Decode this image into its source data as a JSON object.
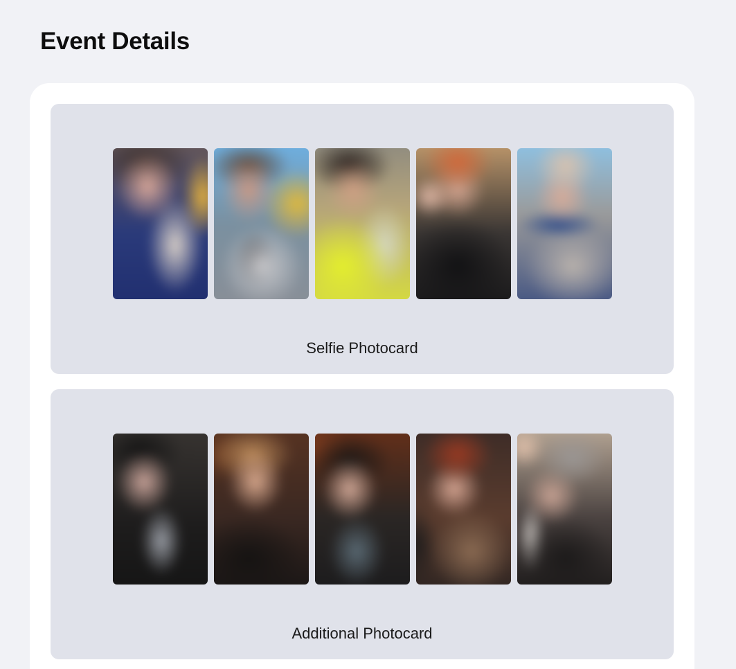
{
  "header": {
    "title": "Event Details"
  },
  "sections": [
    {
      "label": "Selfie Photocard",
      "photocards": [
        {
          "icon": "photocard-image"
        },
        {
          "icon": "photocard-image"
        },
        {
          "icon": "photocard-image"
        },
        {
          "icon": "photocard-image"
        },
        {
          "icon": "photocard-image"
        }
      ]
    },
    {
      "label": "Additional Photocard",
      "photocards": [
        {
          "icon": "photocard-image"
        },
        {
          "icon": "photocard-image"
        },
        {
          "icon": "photocard-image"
        },
        {
          "icon": "photocard-image"
        },
        {
          "icon": "photocard-image"
        }
      ]
    }
  ],
  "colors": {
    "page_background": "#f1f2f6",
    "card_background": "#ffffff",
    "section_background": "#e0e2ea",
    "title_text": "#0d0d0d"
  }
}
